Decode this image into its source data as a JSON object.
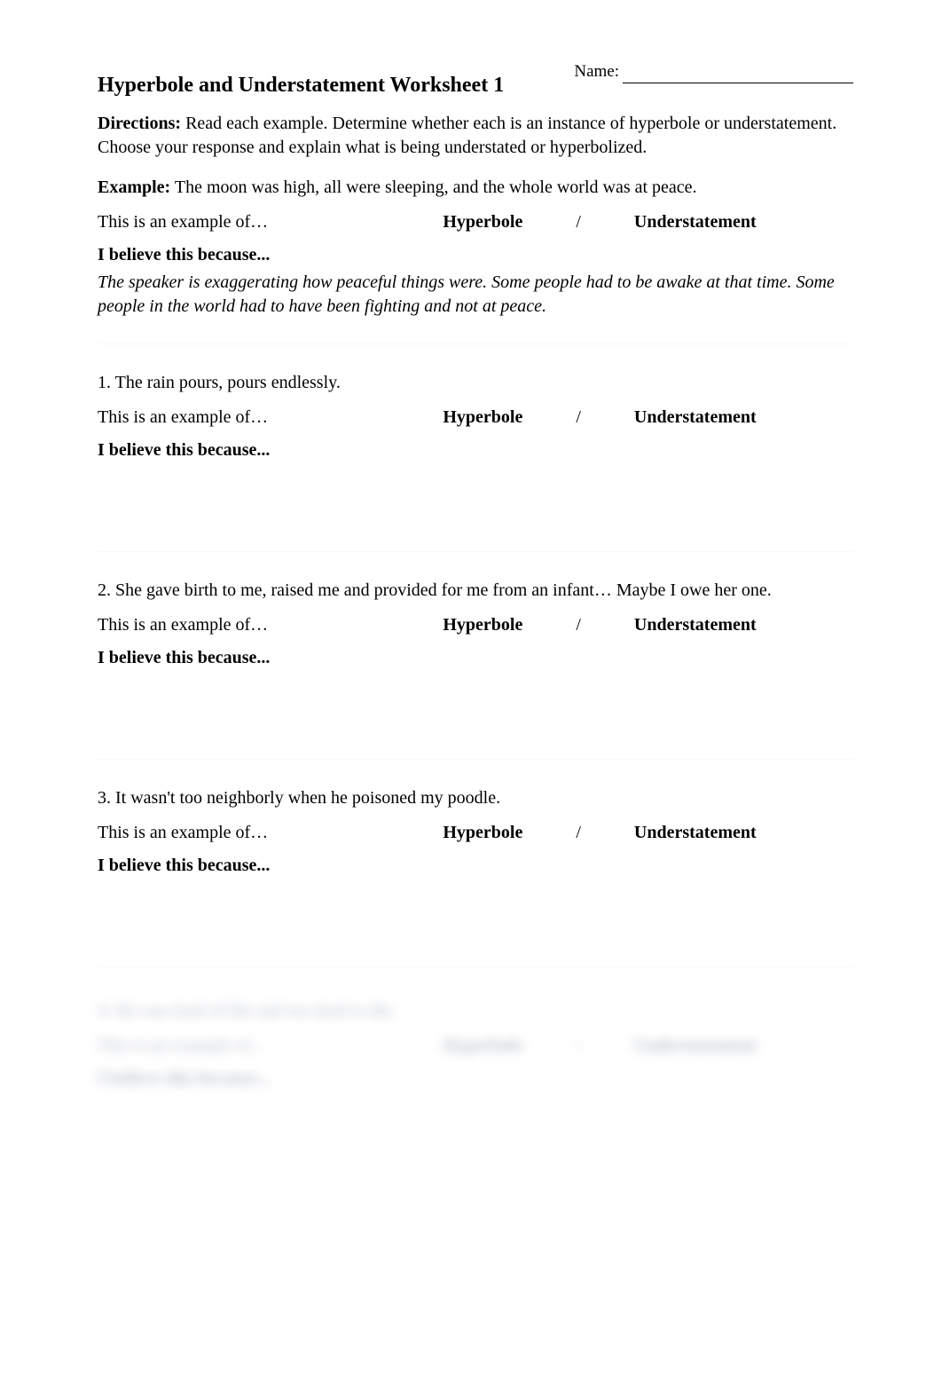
{
  "name_field": {
    "label": "Name:"
  },
  "title": "Hyperbole and Understatement Worksheet 1",
  "directions": {
    "label": "Directions:",
    "text": " Read each example. Determine whether each is an instance of hyperbole or understatement. Choose your response and explain what is being understated or hyperbolized."
  },
  "example": {
    "label": "Example:",
    "text": "  The moon was high, all were sleeping, and the whole world was at peace.",
    "lead": "This is an example of…",
    "option_a": "Hyperbole",
    "slash": "/",
    "option_b": "Understatement",
    "believe_label": "I believe this because...",
    "believe_text": "The speaker is exaggerating how peaceful things were. Some people had to be awake at that time. Some people in the world had to have been fighting and not at peace."
  },
  "questions": [
    {
      "number": "1.",
      "text": "  The rain pours, pours endlessly.",
      "lead": "This is an example of…",
      "option_a": "Hyperbole",
      "slash": "/",
      "option_b": "Understatement",
      "believe_label": "I believe this because..."
    },
    {
      "number": "2.",
      "text": "  She gave birth to me, raised me and provided for me from an infant… Maybe I owe her one.",
      "lead": "This is an example of…",
      "option_a": "Hyperbole",
      "slash": "/",
      "option_b": "Understatement",
      "believe_label": "I believe this because..."
    },
    {
      "number": "3.",
      "text": "  It wasn't too neighborly when he poisoned my poodle.",
      "lead": "This is an example of…",
      "option_a": "Hyperbole",
      "slash": "/",
      "option_b": "Understatement",
      "believe_label": "I believe this because..."
    }
  ],
  "blurred_question": {
    "number": "4.",
    "text": "  He was tired of life and too tired to die.",
    "lead": "This is an example of…",
    "option_a": "Hyperbole",
    "slash": "/",
    "option_b": "Understatement",
    "believe_label": "I believe this because..."
  }
}
